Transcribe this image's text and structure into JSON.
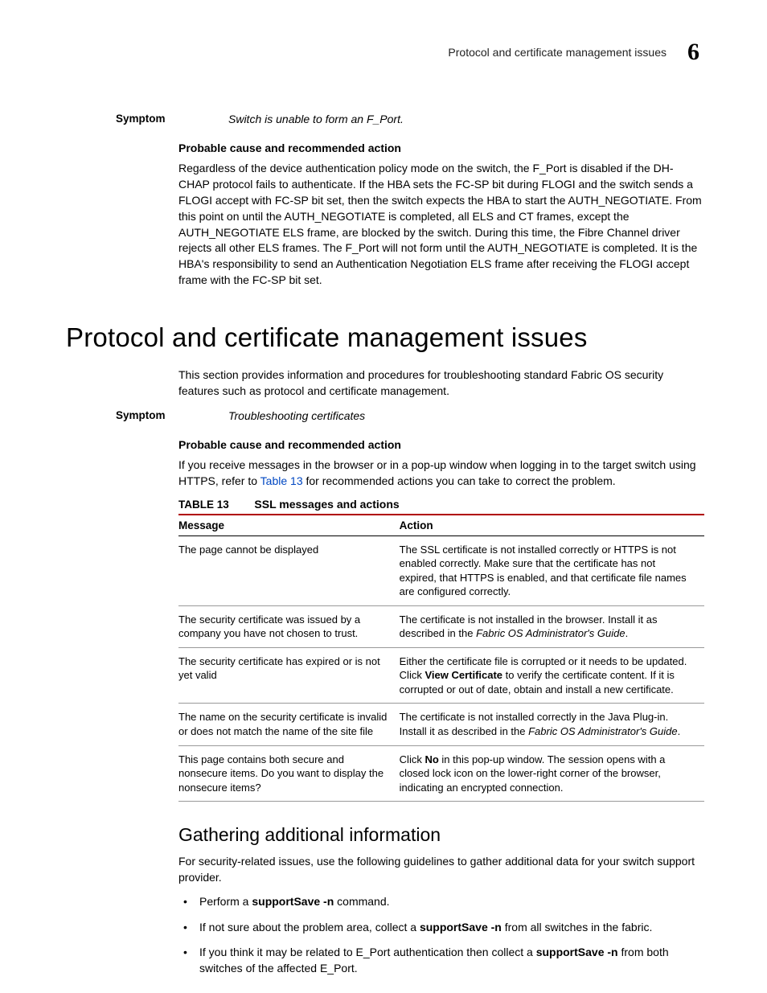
{
  "header": {
    "running_title": "Protocol and certificate management issues",
    "chapter_number": "6"
  },
  "symptom1": {
    "label": "Symptom",
    "text": "Switch is unable to form an F_Port.",
    "sub_heading": "Probable cause and recommended action",
    "body": "Regardless of the device authentication policy mode on the switch, the F_Port is disabled if the DH-CHAP protocol fails to authenticate. If the HBA sets the FC-SP bit during FLOGI and the switch sends a FLOGI accept with FC-SP bit set, then the switch expects the HBA to start the AUTH_NEGOTIATE. From this point on until the AUTH_NEGOTIATE is completed, all ELS and CT frames, except the AUTH_NEGOTIATE ELS frame, are blocked by the switch. During this time, the Fibre Channel driver rejects all other ELS frames. The F_Port will not form until the AUTH_NEGOTIATE is completed. It is the HBA's responsibility to send an Authentication Negotiation ELS frame after receiving the FLOGI accept frame with the FC-SP bit set."
  },
  "section": {
    "title": "Protocol and certificate management issues",
    "intro": "This section provides information and procedures for troubleshooting standard Fabric OS security features such as protocol and certificate management."
  },
  "symptom2": {
    "label": "Symptom",
    "text": "Troubleshooting certificates",
    "sub_heading": "Probable cause and recommended action",
    "body_pre": "If you receive messages in the browser or in a pop-up window when logging in to the target switch using HTTPS, refer to ",
    "body_link": "Table 13",
    "body_post": " for recommended actions you can take to correct the problem."
  },
  "table": {
    "label": "TABLE 13",
    "title": "SSL messages and actions",
    "headers": {
      "col1": "Message",
      "col2": "Action"
    },
    "rows": [
      {
        "msg": "The page cannot be displayed",
        "action": "The SSL certificate is not installed correctly or HTTPS is not enabled correctly. Make sure that the certificate has not expired, that HTTPS is enabled, and that certificate file names are configured correctly."
      },
      {
        "msg": "The security certificate was issued by a company you have not chosen to trust.",
        "action_pre": "The certificate is not installed in the browser. Install it as described in the ",
        "action_em": "Fabric OS Administrator's Guide",
        "action_post": "."
      },
      {
        "msg": "The security certificate has expired or is not yet valid",
        "action_pre": "Either the certificate file is corrupted or it needs to be updated. Click ",
        "action_bold": "View Certificate",
        "action_post": " to verify the certificate content. If it is corrupted or out of date, obtain and install a new certificate."
      },
      {
        "msg": "The name on the security certificate is invalid or does not match the name of the site file",
        "action_pre": "The certificate is not installed correctly in the Java Plug-in. Install it as described in the ",
        "action_em": "Fabric OS Administrator's Guide",
        "action_post": "."
      },
      {
        "msg": "This page contains both secure and nonsecure items. Do you want to display the nonsecure items?",
        "action_pre": "Click ",
        "action_bold": "No",
        "action_post": " in this pop-up window. The session opens with a closed lock icon on the lower-right corner of the browser, indicating an encrypted connection."
      }
    ]
  },
  "subsection": {
    "title": "Gathering additional information",
    "intro": "For security-related issues, use the following guidelines to gather additional data for your switch support provider.",
    "bullets": [
      {
        "pre": "Perform a ",
        "bold": "supportSave -n",
        "post": " command."
      },
      {
        "pre": "If not sure about the problem area, collect a ",
        "bold": "supportSave -n",
        "post": " from all switches in the fabric."
      },
      {
        "pre": "If you think it may be related to E_Port authentication then collect a ",
        "bold": "supportSave -n",
        "post": " from both switches of the affected E_Port."
      }
    ]
  }
}
